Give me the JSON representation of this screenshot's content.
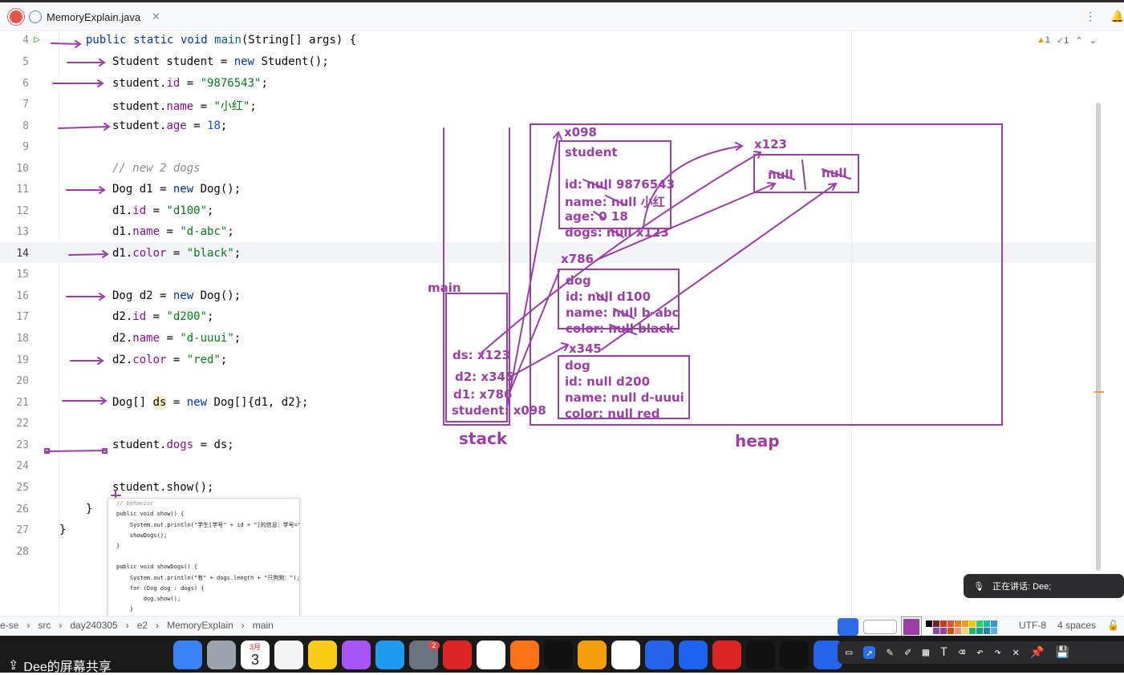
{
  "tab": {
    "filename": "MemoryExplain.java",
    "recording_overlay": "录制中"
  },
  "inspections": {
    "warnings": "1",
    "ok": "1"
  },
  "line_numbers": [
    "4",
    "5",
    "6",
    "7",
    "8",
    "9",
    "10",
    "11",
    "12",
    "13",
    "14",
    "15",
    "16",
    "17",
    "18",
    "19",
    "20",
    "21",
    "22",
    "23",
    "24",
    "25",
    "26",
    "27",
    "28"
  ],
  "code": {
    "l4": [
      "public static void ",
      "main",
      "(String[] args) {"
    ],
    "l5": [
      "Student student = ",
      "new ",
      "Student();"
    ],
    "l6": [
      "student.",
      "id",
      " = ",
      "\"9876543\"",
      ";"
    ],
    "l7": [
      "student.",
      "name",
      " = ",
      "\"小红\"",
      ";"
    ],
    "l8": [
      "student.",
      "age",
      " = ",
      "18",
      ";"
    ],
    "l10": "// new 2 dogs",
    "l11": [
      "Dog d1 = ",
      "new ",
      "Dog();"
    ],
    "l12": [
      "d1.",
      "id",
      " = ",
      "\"d100\"",
      ";"
    ],
    "l13": [
      "d1.",
      "name",
      " = ",
      "\"d-abc\"",
      ";"
    ],
    "l14": [
      "d1.",
      "color",
      " = ",
      "\"black\"",
      ";"
    ],
    "l16": [
      "Dog d2 = ",
      "new ",
      "Dog();"
    ],
    "l17": [
      "d2.",
      "id",
      " = ",
      "\"d200\"",
      ";"
    ],
    "l18": [
      "d2.",
      "name",
      " = ",
      "\"d-uuui\"",
      ";"
    ],
    "l19": [
      "d2.",
      "color",
      " = ",
      "\"red\"",
      ";"
    ],
    "l21": [
      "Dog[] ",
      "ds",
      " = ",
      "new ",
      "Dog[]{d1, d2};"
    ],
    "l23": [
      "student.",
      "dogs",
      " = ds;"
    ],
    "l25": "student.show();",
    "l26": "}",
    "l27": "}"
  },
  "diagram": {
    "stack_title": "stack",
    "heap_title": "heap",
    "frame_label": "main",
    "stack_vars": [
      "ds: x123",
      "d2: x345",
      "d1: x786",
      "student: x098"
    ],
    "student_obj": {
      "addr": "x098",
      "lines": [
        "student",
        "",
        "id: null 9876543",
        "name: null 小红",
        "age: 0 18",
        "dogs: null x123"
      ]
    },
    "array_obj": {
      "addr": "x123",
      "cells": [
        "null",
        "null"
      ]
    },
    "dog1_obj": {
      "addr": "x786",
      "lines": [
        "dog",
        "id: null d100",
        "name: null b-abc",
        "color: null black"
      ]
    },
    "dog2_obj": {
      "addr": "x345",
      "lines": [
        "dog",
        "id: null d200",
        "name: null d-uuui",
        "color: null red"
      ]
    },
    "color": "#9b3fa6"
  },
  "popup": {
    "lines": [
      "// behavior",
      "public void show() {",
      "    System.out.println(\"学生[学号\" + id + \"]的信息：学号=\"",
      "    showDogs();",
      "}",
      "",
      "public void showDogs() {",
      "    System.out.println(\"有\" + dogs.length + \"只狗狗：\");",
      "    for (Dog dog : dogs) {",
      "        dog.show();",
      "    }",
      "}"
    ]
  },
  "toast": {
    "text": "正在讲话:  Dee;"
  },
  "statusbar": {
    "crumbs": [
      "e-se",
      "src",
      "day240305",
      "e2",
      "MemoryExplain",
      "main"
    ],
    "encoding": "UTF-8",
    "indent": "4 spaces"
  },
  "dock": {
    "share_label": "Dee的屏幕共享",
    "apps": [
      "finder-icon",
      "launchpad-icon",
      "calendar-icon",
      "reminders-icon",
      "notes-icon",
      "podcasts-icon",
      "app-store-icon",
      "settings-icon",
      "netease-music-icon",
      "chrome-icon",
      "firefox-icon",
      "terminal-icon",
      "sublime-icon",
      "slack-icon",
      "vscode-icon",
      "docker-icon",
      "xmind-icon",
      "intellij-icon",
      "intellij-ce-icon",
      "app-icon"
    ],
    "calendar_month": "3月",
    "calendar_day": "3",
    "settings_badge": "2"
  }
}
